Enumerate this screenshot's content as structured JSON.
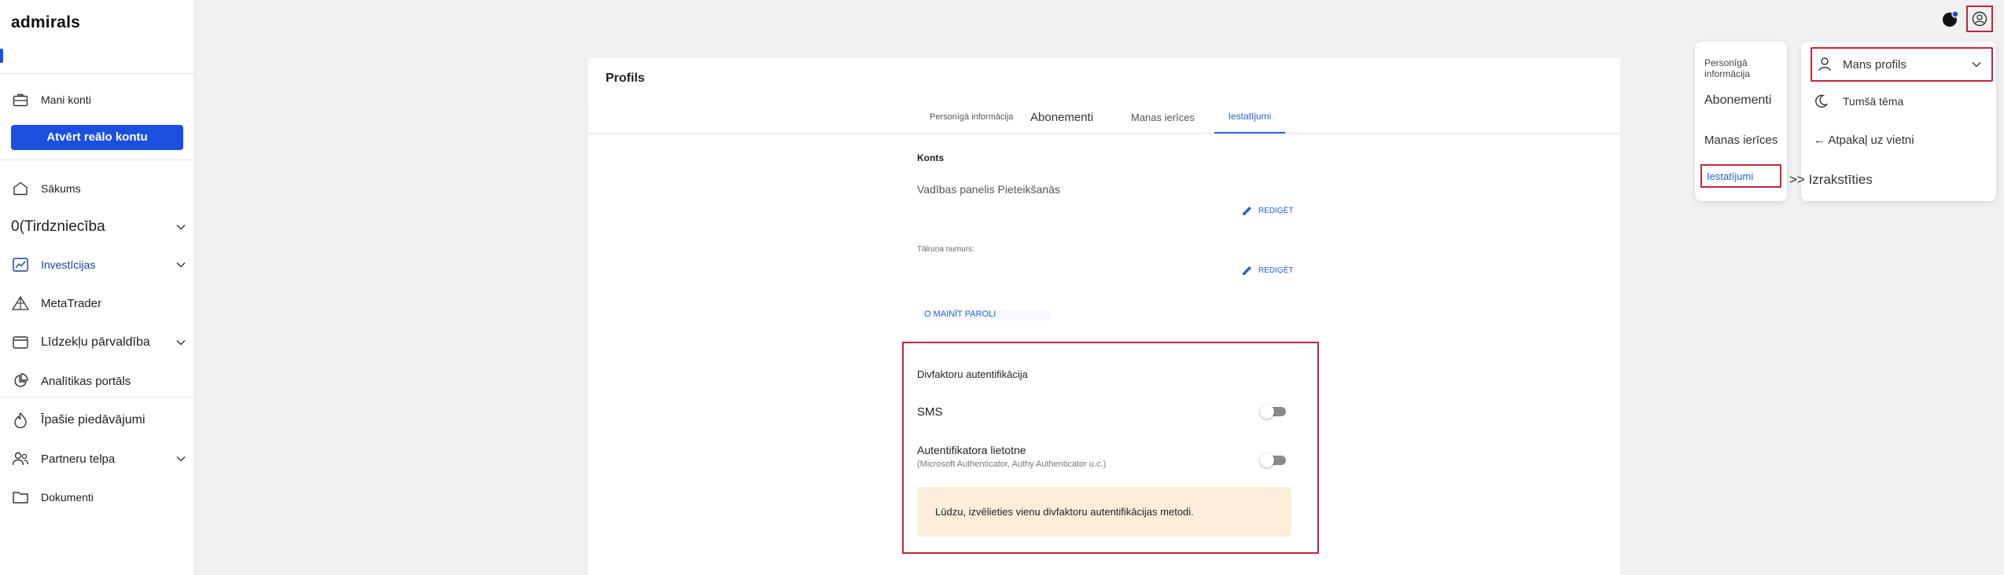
{
  "sidebar": {
    "logo": "admirals",
    "my_accounts": "Mani konti",
    "open_real_account": "Atvērt reālo kontu",
    "items": [
      {
        "label": "Sākums"
      },
      {
        "label": "Tirdzniecība",
        "prefix": "0("
      },
      {
        "label": "Investīcijas"
      },
      {
        "label": "MetaTrader"
      },
      {
        "label": "Līdzekļu pārvaldība"
      },
      {
        "label": "Analītikas portāls"
      },
      {
        "label": "Īpašie piedāvājumi"
      },
      {
        "label": "Partneru telpa"
      },
      {
        "label": "Dokumenti"
      }
    ]
  },
  "profile": {
    "title": "Profils",
    "tabs": [
      "Personīgā informācija",
      "Abonementi",
      "Manas ierīces",
      "Iestatījumi"
    ],
    "account_label": "Konts",
    "dashboard_login": "Vadības panelis Pieteikšanās",
    "edit_label": "REDIĢĒT",
    "phone_label": "Tālruņa numurs:",
    "change_password": "O MAINĪT PAROLI",
    "tfa": {
      "title": "Divfaktoru autentifikācija",
      "sms": "SMS",
      "auth_app": "Autentifikatora lietotne",
      "auth_app_sub": "(Microsoft Authenticator, Authy Authenticator u.c.)",
      "notice": "Lūdzu, izvēlieties vienu divfaktoru autentifikācijas metodi.",
      "sms_enabled": false,
      "app_enabled": false
    }
  },
  "profile_menu": {
    "items": [
      "Personīgā informācija",
      "Abonementi",
      "Manas ierīces",
      "Iestatījumi"
    ]
  },
  "user_menu": {
    "my_profile": "Mans profils",
    "dark_theme": "Tumšā tēma",
    "back_to_site": "← Atpakaļ uz vietni",
    "logout": ">> Izrakstīties"
  },
  "colors": {
    "accent": "#1a4fe0",
    "link": "#2860d8",
    "highlight": "#c0273a",
    "notice_bg": "#fdeedb"
  }
}
